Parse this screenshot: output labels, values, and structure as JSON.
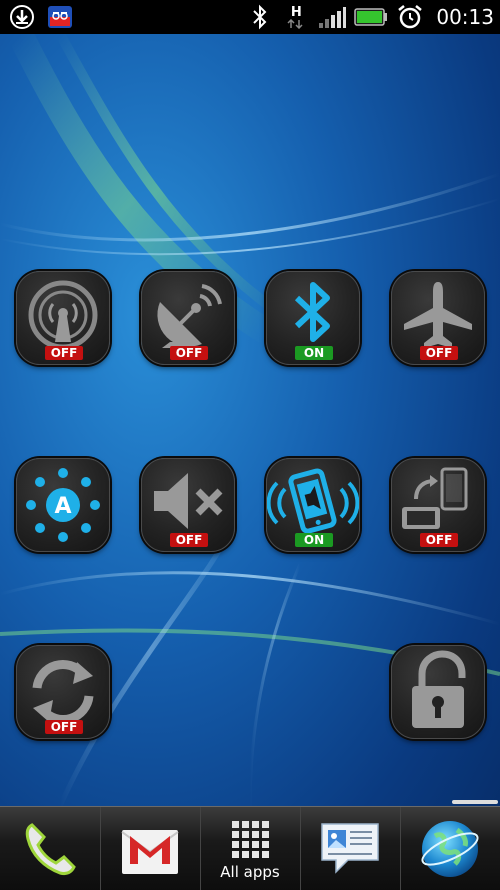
{
  "status_bar": {
    "time": "00:13",
    "network_type": "H",
    "icons": [
      "download-icon",
      "app-notification-icon",
      "bluetooth-icon",
      "network-h-icon",
      "signal-icon",
      "battery-icon",
      "alarm-icon"
    ]
  },
  "toggles": [
    {
      "name": "wifi-hotspot",
      "icon": "hotspot-icon",
      "state": "OFF"
    },
    {
      "name": "gps",
      "icon": "satellite-dish-icon",
      "state": "OFF"
    },
    {
      "name": "bluetooth",
      "icon": "bluetooth-icon",
      "state": "ON"
    },
    {
      "name": "airplane-mode",
      "icon": "airplane-icon",
      "state": "OFF"
    },
    {
      "name": "auto-brightness",
      "icon": "auto-brightness-icon",
      "state": ""
    },
    {
      "name": "sound",
      "icon": "mute-icon",
      "state": "OFF"
    },
    {
      "name": "vibrate",
      "icon": "vibrate-phone-icon",
      "state": "ON"
    },
    {
      "name": "auto-rotate",
      "icon": "rotate-screen-icon",
      "state": "OFF"
    },
    {
      "name": "sync",
      "icon": "sync-icon",
      "state": "OFF"
    },
    {
      "name": "screen-lock",
      "icon": "unlock-icon",
      "state": ""
    }
  ],
  "dock": {
    "phone": {
      "icon": "phone-icon"
    },
    "mail": {
      "icon": "gmail-icon"
    },
    "all_apps": {
      "icon": "grid-icon",
      "label": "All apps"
    },
    "messages": {
      "icon": "message-icon"
    },
    "browser": {
      "icon": "globe-icon"
    }
  },
  "colors": {
    "accent_blue": "#22aee8",
    "off_badge": "#c41010",
    "on_badge": "#1b9a22",
    "tile_bg": "#232323"
  }
}
